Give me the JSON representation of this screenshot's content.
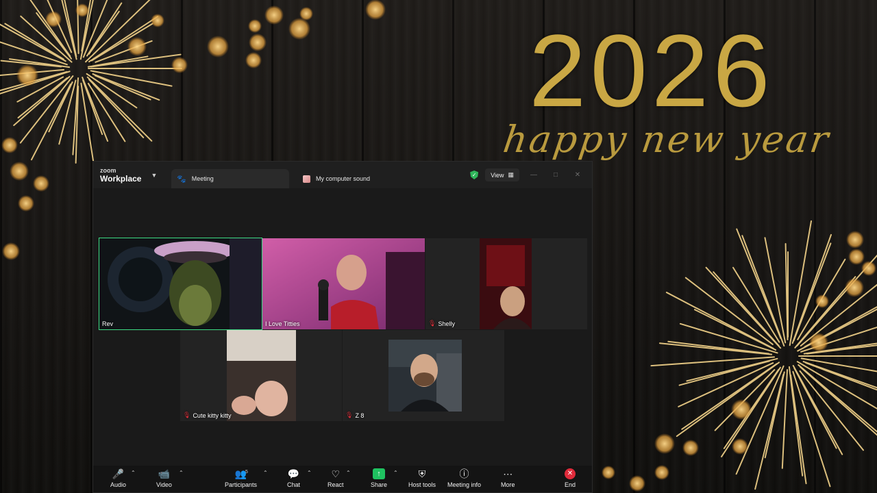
{
  "background": {
    "year": "2026",
    "greeting": "happy new year",
    "accent_color": "#c9a744"
  },
  "window": {
    "brand_small": "zoom",
    "brand_large": "Workplace",
    "tabs": [
      {
        "label": "Meeting",
        "icon": "paw-icon"
      },
      {
        "label": "My computer sound",
        "icon": "sound-icon"
      }
    ],
    "view_label": "View",
    "security_icon": "shield-check-icon"
  },
  "participants": [
    {
      "name": "Rev",
      "muted": false,
      "active_speaker": true
    },
    {
      "name": "I Love Titties",
      "muted": false,
      "active_speaker": false
    },
    {
      "name": "Shelly",
      "muted": true,
      "active_speaker": false
    },
    {
      "name": "Cute kitty kitty",
      "muted": true,
      "active_speaker": false
    },
    {
      "name": "Z 8",
      "muted": true,
      "active_speaker": false
    },
    {
      "name": "",
      "muted": false,
      "active_speaker": false
    }
  ],
  "toolbar": {
    "audio": "Audio",
    "video": "Video",
    "participants": "Participants",
    "participants_count": "5",
    "chat": "Chat",
    "react": "React",
    "share": "Share",
    "host_tools": "Host tools",
    "meeting_info": "Meeting info",
    "more": "More",
    "end": "End"
  }
}
